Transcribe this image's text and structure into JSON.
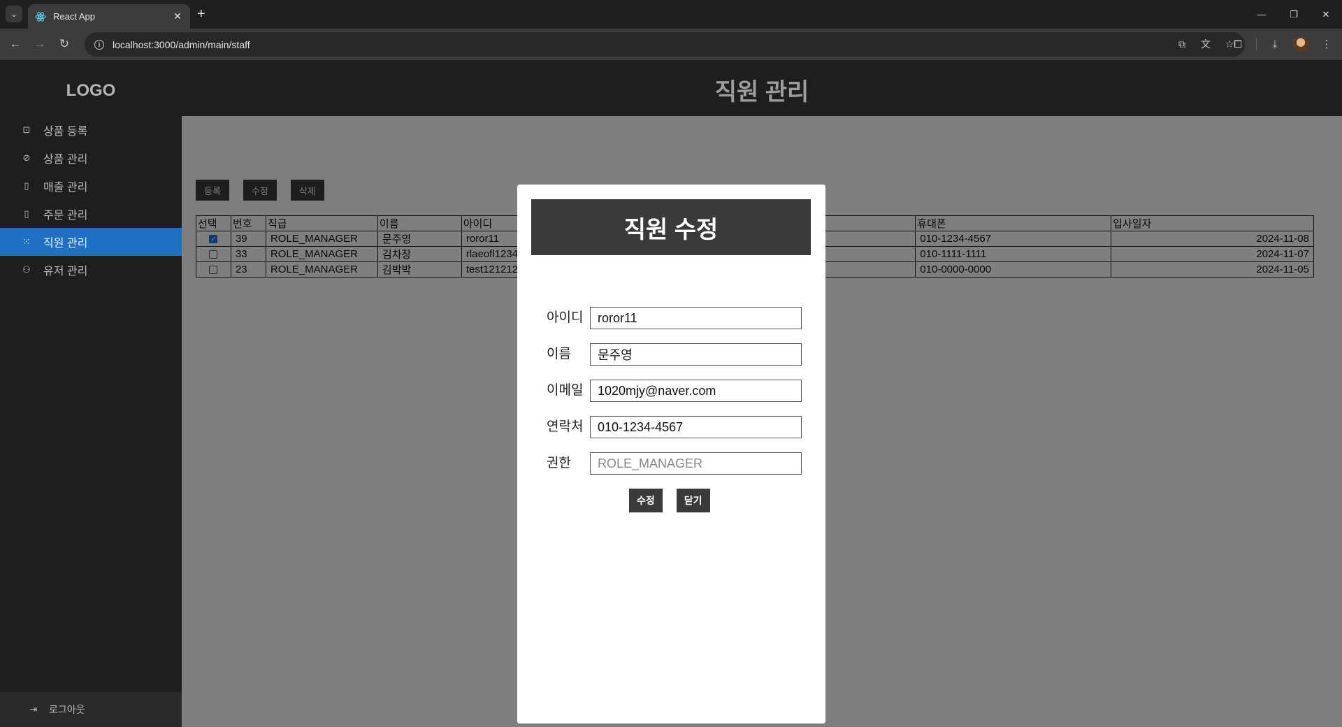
{
  "browser": {
    "tab_title": "React App",
    "url": "localhost:3000/admin/main/staff"
  },
  "sidebar": {
    "logo": "LOGO",
    "items": [
      {
        "label": "상품 등록",
        "icon": "bag-icon"
      },
      {
        "label": "상품 관리",
        "icon": "tag-icon"
      },
      {
        "label": "매출 관리",
        "icon": "building-icon"
      },
      {
        "label": "주문 관리",
        "icon": "building-icon"
      },
      {
        "label": "직원 관리",
        "icon": "grid-icon",
        "active": true
      },
      {
        "label": "유저 관리",
        "icon": "user-icon"
      }
    ],
    "logout_label": "로그아웃"
  },
  "header": {
    "title": "직원 관리"
  },
  "actions": {
    "register": "등록",
    "edit": "수정",
    "delete": "삭제"
  },
  "table": {
    "headers": [
      "선택",
      "번호",
      "직급",
      "이름",
      "아이디",
      "",
      "휴대폰",
      "입사일자"
    ],
    "rows": [
      {
        "checked": true,
        "no": "39",
        "rank": "ROLE_MANAGER",
        "name": "문주영",
        "id": "roror11",
        "phone": "010-1234-4567",
        "date": "2024-11-08"
      },
      {
        "checked": false,
        "no": "33",
        "rank": "ROLE_MANAGER",
        "name": "김차장",
        "id": "rlaeofl1234",
        "phone": "010-1111-1111",
        "date": "2024-11-07"
      },
      {
        "checked": false,
        "no": "23",
        "rank": "ROLE_MANAGER",
        "name": "김박박",
        "id": "test121212",
        "phone": "010-0000-0000",
        "date": "2024-11-05"
      }
    ]
  },
  "modal": {
    "title": "직원 수정",
    "fields": [
      {
        "label": "아이디",
        "value": "roror11"
      },
      {
        "label": "이름",
        "value": "문주영"
      },
      {
        "label": "이메일",
        "value": "1020mjy@naver.com"
      },
      {
        "label": "연락처",
        "value": "010-1234-4567"
      },
      {
        "label": "권한",
        "placeholder": "ROLE_MANAGER"
      }
    ],
    "submit_label": "수정",
    "close_label": "닫기"
  },
  "colors": {
    "sidebar_bg": "#1e1e1e",
    "active_item": "#1f6fc5",
    "button_bg": "#3a3a3a"
  }
}
